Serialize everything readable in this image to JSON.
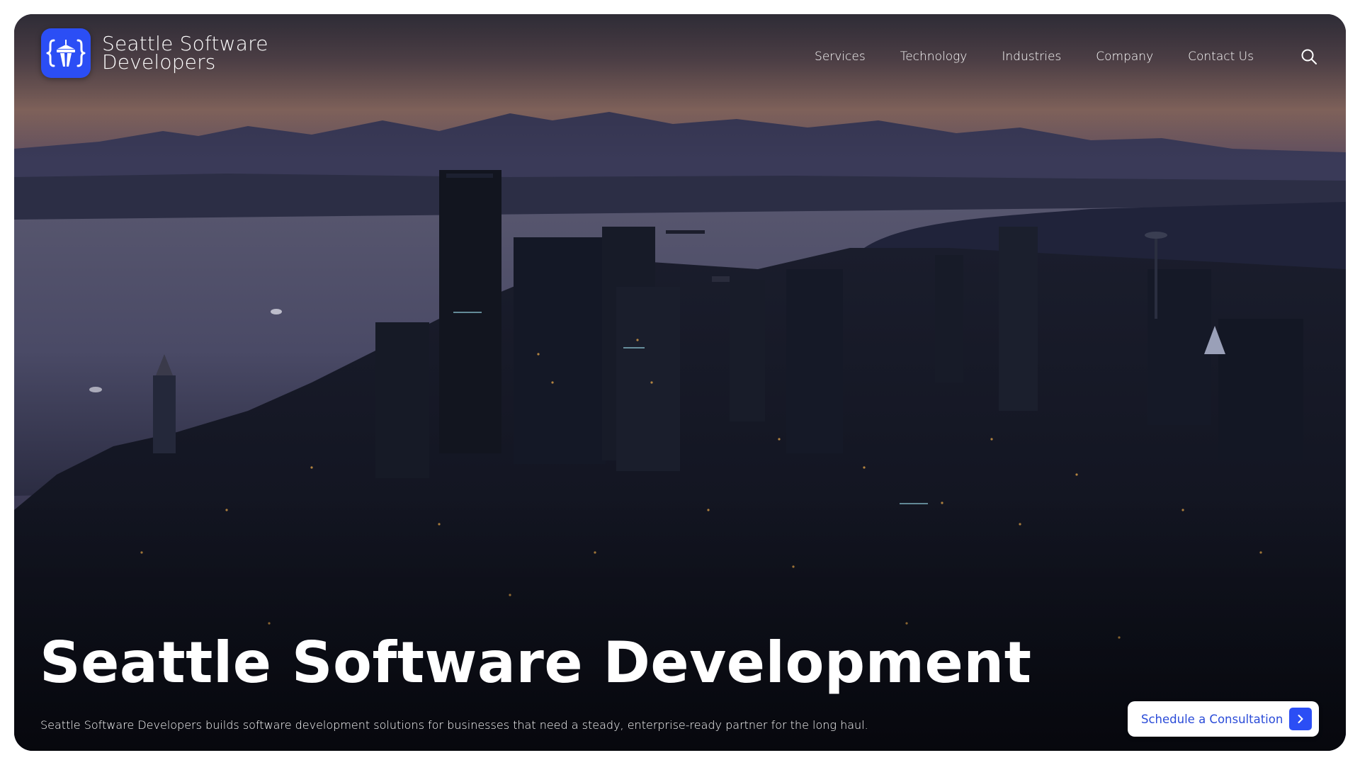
{
  "brand": {
    "name_line1": "Seattle Software",
    "name_line2": "Developers",
    "accent_color": "#2b4ef5",
    "logo_icon": "space-needle-braces-icon"
  },
  "nav": {
    "items": [
      {
        "label": "Services"
      },
      {
        "label": "Technology"
      },
      {
        "label": "Industries"
      },
      {
        "label": "Company"
      },
      {
        "label": "Contact Us"
      }
    ],
    "search_icon": "search-icon"
  },
  "hero": {
    "title": "Seattle Software Development",
    "subtitle": "Seattle Software Developers builds software development solutions for businesses that need a steady, enterprise-ready partner for the long haul.",
    "background": "seattle-skyline-dusk-photo"
  },
  "cta": {
    "label": "Schedule a Consultation",
    "icon": "chevron-right-icon",
    "text_color": "#2a4bd8"
  }
}
